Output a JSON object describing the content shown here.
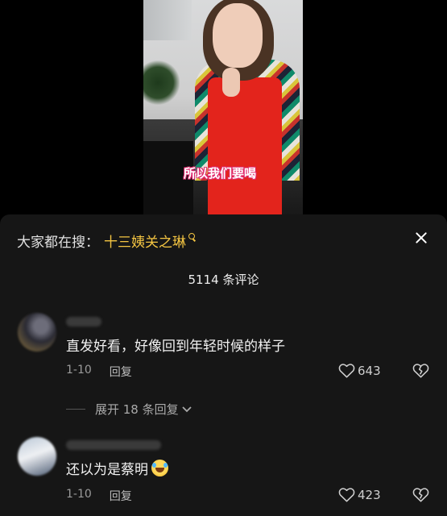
{
  "video": {
    "subtitle": "所以我们要喝"
  },
  "sheet": {
    "search_label": "大家都在搜：",
    "search_term": "十三姨关之琳",
    "comment_count": "5114 条评论",
    "comments": [
      {
        "text": "直发好看，好像回到年轻时候的样子",
        "date": "1-10",
        "reply_label": "回复",
        "likes": "643",
        "expand_label": "展开 18 条回复"
      },
      {
        "text": "还以为是蔡明",
        "date": "1-10",
        "reply_label": "回复",
        "likes": "423"
      }
    ]
  },
  "icons": {
    "search": "search-icon",
    "close": "close-icon",
    "like": "heart-outline-icon",
    "dislike": "broken-heart-icon",
    "expand": "chevron-down-icon",
    "emoji": "laugh-crying-emoji-icon"
  },
  "colors": {
    "accent_search": "#f4c542",
    "sheet_background": "#161616",
    "subtitle_outline": "#e02a6f"
  }
}
